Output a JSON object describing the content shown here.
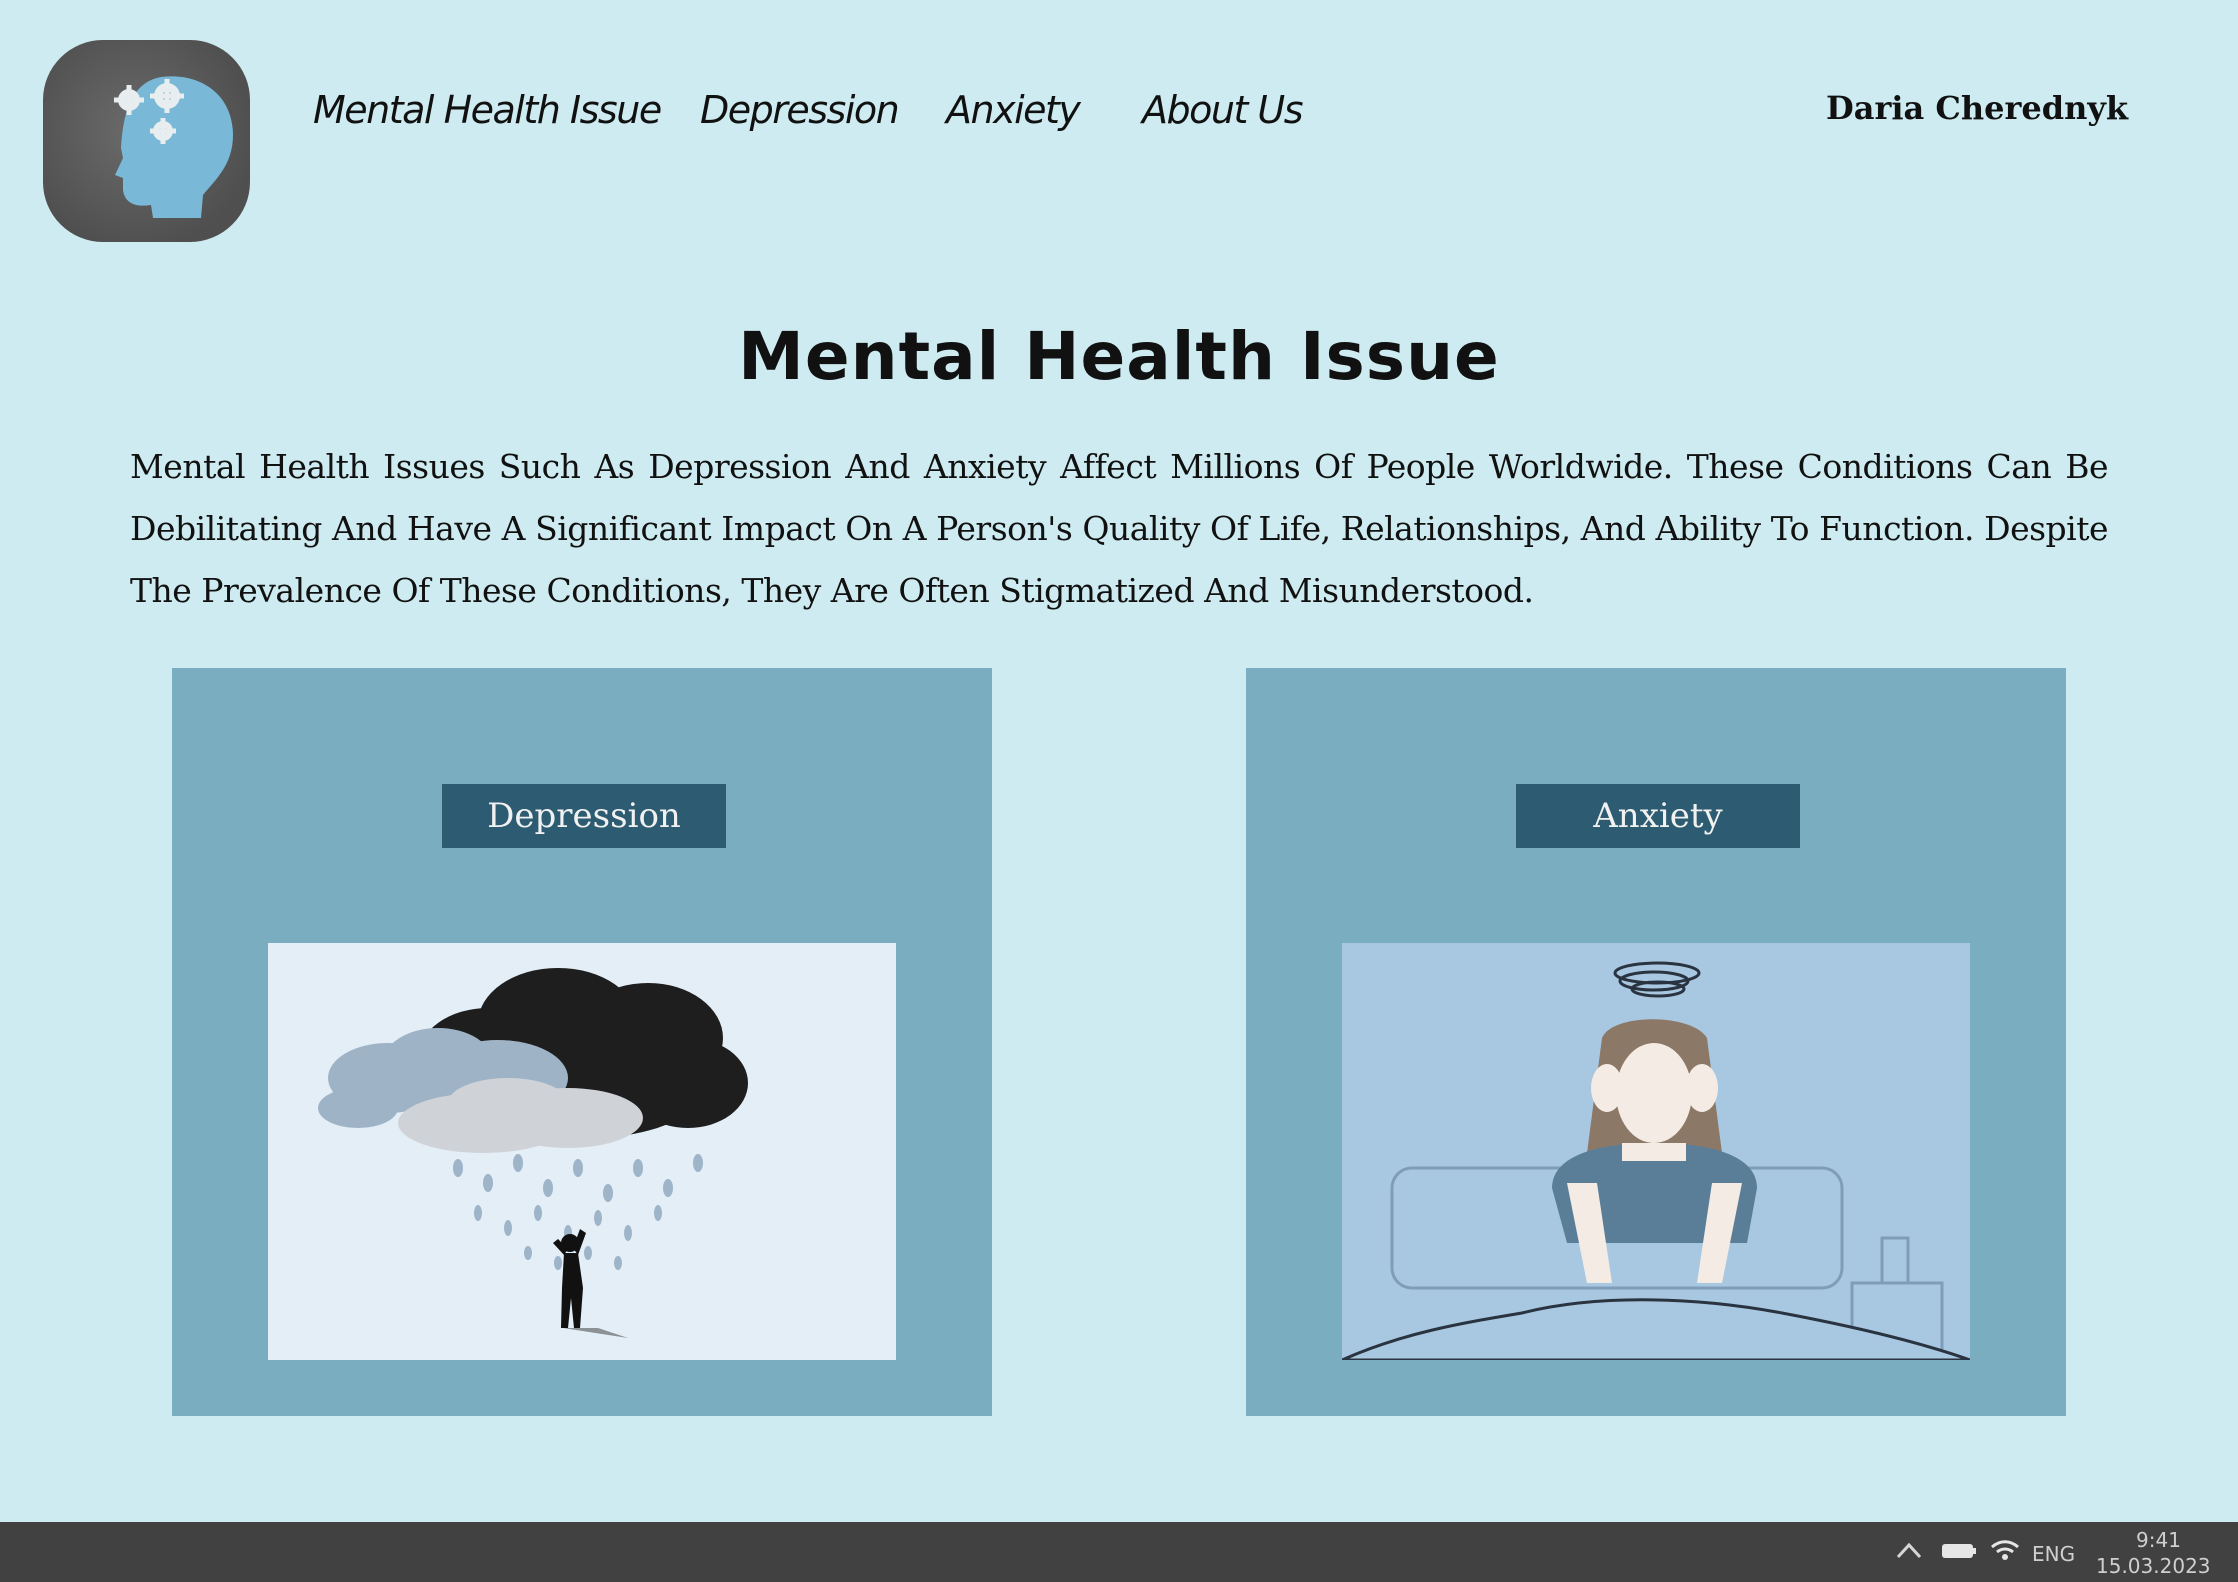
{
  "header": {
    "logo_icon": "head-gears-icon",
    "nav": [
      {
        "label": "Mental Health Issue"
      },
      {
        "label": "Depression"
      },
      {
        "label": "Anxiety"
      },
      {
        "label": "About Us"
      }
    ],
    "user_name": "Daria Cherednyk"
  },
  "main": {
    "title": "Mental Health Issue",
    "intro": "Mental Health Issues Such As Depression And Anxiety Affect Millions Of People Worldwide. These Conditions Can Be Debilitating And Have A Significant Impact On A Person's Quality Of Life, Relationships, And Ability To Function. Despite The Prevalence Of These Conditions, They Are Often Stigmatized And Misunderstood.",
    "cards": [
      {
        "label": "Depression",
        "image": "rain-cloud-person-illustration"
      },
      {
        "label": "Anxiety",
        "image": "stressed-woman-in-bed-illustration"
      }
    ]
  },
  "taskbar": {
    "tray_icons": [
      "chevron-up-icon",
      "battery-icon",
      "wifi-icon"
    ],
    "language": "ENG",
    "time": "9:41",
    "date": "15.03.2023"
  },
  "colors": {
    "page_bg": "#cdebf0",
    "card_bg": "#79adbf",
    "label_bg": "#2d5c72",
    "taskbar_bg": "#414141"
  }
}
